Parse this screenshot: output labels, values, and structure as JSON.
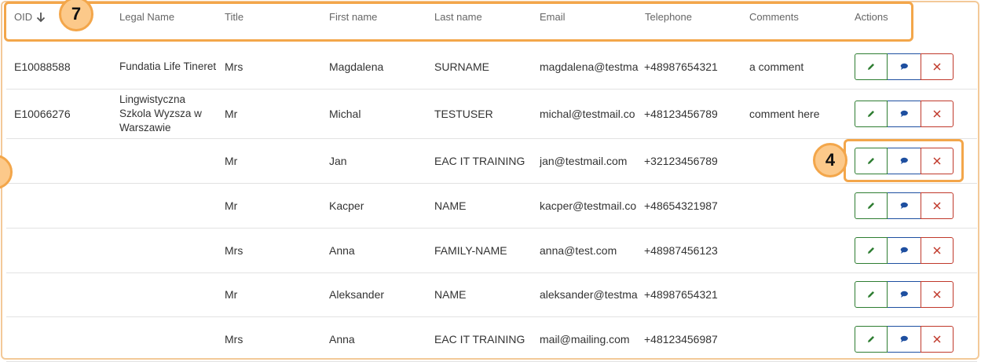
{
  "columns": {
    "oid": "OID",
    "legal_name": "Legal Name",
    "title": "Title",
    "first_name": "First name",
    "last_name": "Last name",
    "email": "Email",
    "telephone": "Telephone",
    "comments": "Comments",
    "actions": "Actions"
  },
  "icons": {
    "sort": "arrow-down-icon",
    "edit": "pencil-icon",
    "comment": "speech-bubble-icon",
    "delete": "close-icon"
  },
  "rows": [
    {
      "oid": "E10088588",
      "legal_name": "Fundatia Life Tineret",
      "title": "Mrs",
      "first_name": "Magdalena",
      "last_name": "SURNAME",
      "email": "magdalena@testma",
      "telephone": "+48987654321",
      "comments": "a comment"
    },
    {
      "oid": "E10066276",
      "legal_name": "Lingwistyczna Szkola Wyzsza w Warszawie",
      "title": "Mr",
      "first_name": "Michal",
      "last_name": "TESTUSER",
      "email": "michal@testmail.co",
      "telephone": "+48123456789",
      "comments": "comment here"
    },
    {
      "oid": "",
      "legal_name": "",
      "title": "Mr",
      "first_name": "Jan",
      "last_name": "EAC IT TRAINING",
      "email": "jan@testmail.com",
      "telephone": "+32123456789",
      "comments": ""
    },
    {
      "oid": "",
      "legal_name": "",
      "title": "Mr",
      "first_name": "Kacper",
      "last_name": "NAME",
      "email": "kacper@testmail.co",
      "telephone": "+48654321987",
      "comments": ""
    },
    {
      "oid": "",
      "legal_name": "",
      "title": "Mrs",
      "first_name": "Anna",
      "last_name": "FAMILY-NAME",
      "email": "anna@test.com",
      "telephone": "+48987456123",
      "comments": ""
    },
    {
      "oid": "",
      "legal_name": "",
      "title": "Mr",
      "first_name": "Aleksander",
      "last_name": "NAME",
      "email": "aleksander@testma",
      "telephone": "+48987654321",
      "comments": ""
    },
    {
      "oid": "",
      "legal_name": "",
      "title": "Mrs",
      "first_name": "Anna",
      "last_name": "EAC IT TRAINING",
      "email": "mail@mailing.com",
      "telephone": "+48123456987",
      "comments": ""
    }
  ],
  "callouts": {
    "header": "7",
    "actions": "4"
  },
  "colors": {
    "highlight": "#f3a64a",
    "badge_fill": "#fcc98a",
    "edit": "#2e7d32",
    "comment": "#1e4fa0",
    "delete": "#c0392b"
  }
}
